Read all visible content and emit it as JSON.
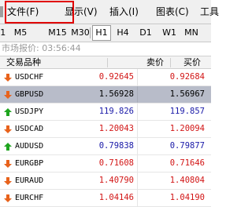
{
  "menu": {
    "file": "文件(F)",
    "view": "显示(V)",
    "insert": "插入(I)",
    "chart": "图表(C)",
    "tools": "工具"
  },
  "timeframes": [
    "M1",
    "M5",
    "M15",
    "M30",
    "H1",
    "H4",
    "D1",
    "W1",
    "MN"
  ],
  "active_timeframe": "H1",
  "market_watch": {
    "title": "市场报价: 03:56:44",
    "col_symbol": "交易品种",
    "col_bid": "卖价",
    "col_ask": "买价"
  },
  "quotes": [
    {
      "symbol": "USDCHF",
      "bid": "0.92645",
      "ask": "0.92684",
      "direction": "down"
    },
    {
      "symbol": "GBPUSD",
      "bid": "1.56928",
      "ask": "1.56967",
      "direction": "down",
      "selected": true
    },
    {
      "symbol": "USDJPY",
      "bid": "119.826",
      "ask": "119.857",
      "direction": "up"
    },
    {
      "symbol": "USDCAD",
      "bid": "1.20043",
      "ask": "1.20094",
      "direction": "down"
    },
    {
      "symbol": "AUDUSD",
      "bid": "0.79838",
      "ask": "0.79877",
      "direction": "up"
    },
    {
      "symbol": "EURGBP",
      "bid": "0.71608",
      "ask": "0.71646",
      "direction": "down"
    },
    {
      "symbol": "EURAUD",
      "bid": "1.40790",
      "ask": "1.40804",
      "direction": "down"
    },
    {
      "symbol": "EURCHF",
      "bid": "1.04146",
      "ask": "1.04190",
      "direction": "down"
    }
  ],
  "colors": {
    "down_arrow": "#e8621b",
    "up_arrow": "#1fa51f",
    "highlight_box": "#e00000",
    "selected_row": "#b8bcc9"
  }
}
